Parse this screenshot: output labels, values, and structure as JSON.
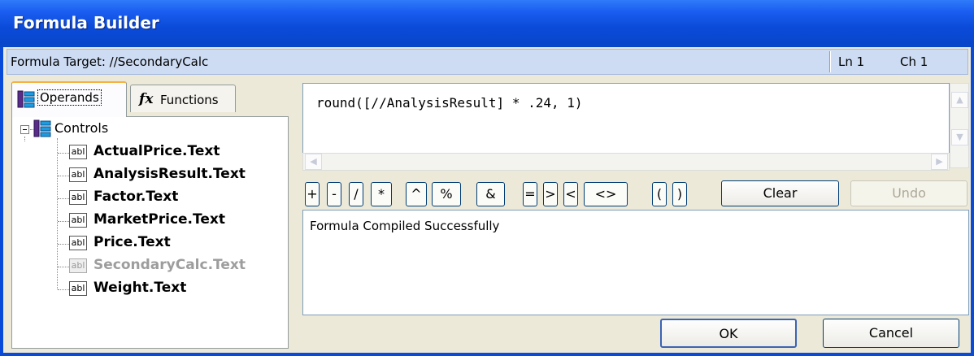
{
  "window": {
    "title": "Formula Builder"
  },
  "infobar": {
    "target": "Formula Target: //SecondaryCalc",
    "line": "Ln 1",
    "char": "Ch 1"
  },
  "tabs": [
    {
      "label": "Operands",
      "icon": "operands-icon",
      "active": true
    },
    {
      "label": "Functions",
      "icon": "fx-icon",
      "active": false
    }
  ],
  "tree": {
    "root": "Controls",
    "items": [
      {
        "label": "ActualPrice.Text",
        "disabled": false
      },
      {
        "label": "AnalysisResult.Text",
        "disabled": false
      },
      {
        "label": "Factor.Text",
        "disabled": false
      },
      {
        "label": "MarketPrice.Text",
        "disabled": false
      },
      {
        "label": "Price.Text",
        "disabled": false
      },
      {
        "label": "SecondaryCalc.Text",
        "disabled": true
      },
      {
        "label": "Weight.Text",
        "disabled": false
      }
    ],
    "item_icon_text": "abl"
  },
  "editor": {
    "formula": "round([//AnalysisResult] * .24, 1)"
  },
  "operators": [
    "+",
    "-",
    "/",
    "*",
    "^",
    "%",
    "&",
    "=",
    ">",
    "<",
    "<>",
    "(",
    ")"
  ],
  "buttons": {
    "clear": "Clear",
    "undo": "Undo",
    "ok": "OK",
    "cancel": "Cancel"
  },
  "message": "Formula Compiled Successfully"
}
